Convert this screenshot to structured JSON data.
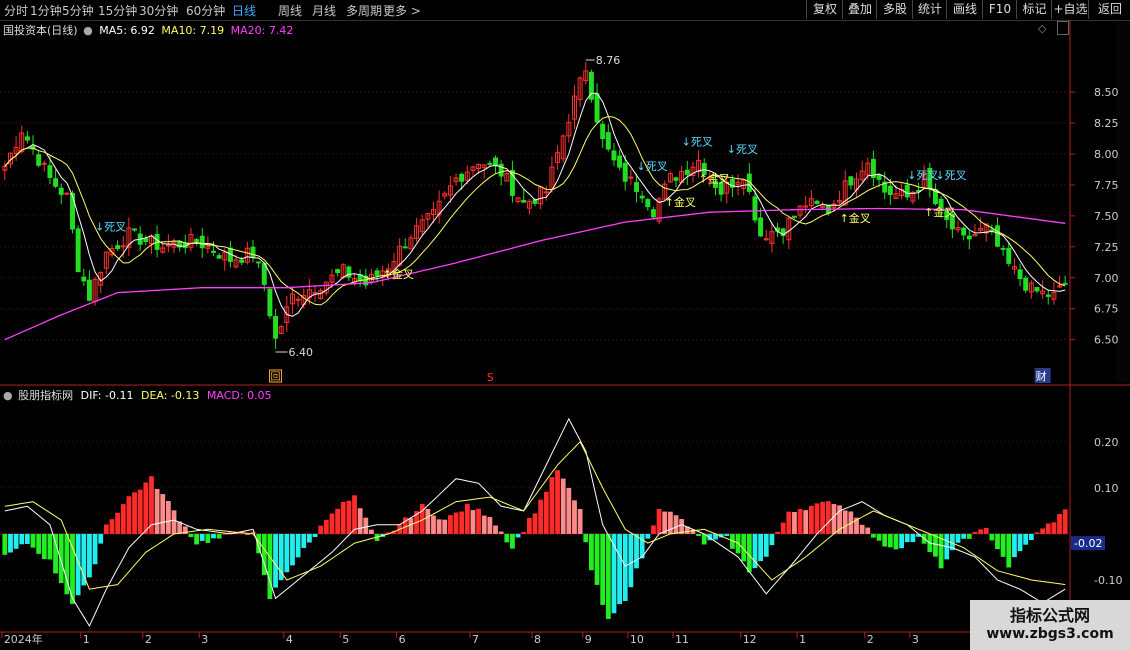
{
  "toolbar": {
    "periods": [
      "分时",
      "1分钟",
      "5分钟",
      "15分钟",
      "30分钟",
      "60分钟",
      "日线",
      "周线",
      "月线",
      "多周期",
      "更多 >"
    ],
    "active_period": "日线",
    "tools": [
      "复权",
      "叠加",
      "多股",
      "统计",
      "画线",
      "F10",
      "标记",
      "+自选",
      "返回"
    ]
  },
  "price_panel": {
    "title": "国投资本(日线)",
    "ma5_label": "MA5: 6.92",
    "ma10_label": "MA10: 7.19",
    "ma20_label": "MA20: 7.42",
    "max_label": "8.76",
    "min_label": "6.40",
    "markers": {
      "hui": "回",
      "s": "S",
      "cai": "财"
    },
    "colors": {
      "up": "#ff3030",
      "down": "#22dd22",
      "ma5": "#ffffff",
      "ma10": "#ffff66",
      "ma20": "#ff40ff"
    }
  },
  "macd_panel": {
    "title": "股朋指标网",
    "dif_label": "DIF: -0.11",
    "dea_label": "DEA: -0.13",
    "macd_label": "MACD: 0.05",
    "current_value": "-0.02"
  },
  "watermark": {
    "line1": "指标公式网",
    "line2": "www.zbgs3.com"
  },
  "chart_data": [
    {
      "type": "candlestick",
      "title": "国投资本(日线)",
      "y_ticks": [
        8.5,
        8.25,
        8.0,
        7.75,
        7.5,
        7.25,
        7.0,
        6.75,
        6.5
      ],
      "ylim": [
        6.4,
        8.76
      ],
      "x_ticks": [
        "2024年",
        "1",
        "2",
        "3",
        "4",
        "5",
        "6",
        "7",
        "8",
        "9",
        "10",
        "11",
        "12",
        "1",
        "2",
        "3"
      ],
      "x_tick_days": [
        0,
        14,
        25,
        35,
        50,
        60,
        70,
        83,
        94,
        103,
        111,
        119,
        131,
        141,
        153,
        161
      ],
      "close_keypoints": [
        [
          0,
          7.9
        ],
        [
          3,
          8.2
        ],
        [
          8,
          7.8
        ],
        [
          11,
          7.65
        ],
        [
          13,
          7.1
        ],
        [
          15,
          6.85
        ],
        [
          18,
          7.2
        ],
        [
          22,
          7.35
        ],
        [
          28,
          7.25
        ],
        [
          34,
          7.3
        ],
        [
          40,
          7.15
        ],
        [
          44,
          7.2
        ],
        [
          46,
          6.95
        ],
        [
          48,
          6.5
        ],
        [
          51,
          6.85
        ],
        [
          56,
          6.95
        ],
        [
          60,
          7.05
        ],
        [
          64,
          6.95
        ],
        [
          68,
          7.1
        ],
        [
          72,
          7.35
        ],
        [
          76,
          7.5
        ],
        [
          80,
          7.8
        ],
        [
          84,
          7.95
        ],
        [
          88,
          7.85
        ],
        [
          92,
          7.6
        ],
        [
          96,
          7.7
        ],
        [
          100,
          8.3
        ],
        [
          103,
          8.7
        ],
        [
          106,
          8.1
        ],
        [
          109,
          7.85
        ],
        [
          113,
          7.7
        ],
        [
          115,
          7.55
        ],
        [
          118,
          7.8
        ],
        [
          123,
          7.95
        ],
        [
          127,
          7.7
        ],
        [
          131,
          7.85
        ],
        [
          134,
          7.35
        ],
        [
          138,
          7.4
        ],
        [
          142,
          7.6
        ],
        [
          146,
          7.55
        ],
        [
          150,
          7.8
        ],
        [
          153,
          7.95
        ],
        [
          156,
          7.7
        ],
        [
          160,
          7.65
        ],
        [
          163,
          7.8
        ],
        [
          166,
          7.5
        ],
        [
          170,
          7.3
        ],
        [
          174,
          7.4
        ],
        [
          178,
          7.1
        ],
        [
          182,
          6.9
        ],
        [
          186,
          6.85
        ],
        [
          188,
          6.95
        ]
      ],
      "series": [
        {
          "name": "MA5",
          "value": 6.92
        },
        {
          "name": "MA10",
          "value": 7.19
        },
        {
          "name": "MA20",
          "value": 7.42,
          "keypoints": [
            [
              0,
              6.5
            ],
            [
              10,
              6.7
            ],
            [
              20,
              6.88
            ],
            [
              35,
              6.92
            ],
            [
              50,
              6.92
            ],
            [
              65,
              6.96
            ],
            [
              80,
              7.12
            ],
            [
              95,
              7.3
            ],
            [
              110,
              7.45
            ],
            [
              125,
              7.53
            ],
            [
              140,
              7.55
            ],
            [
              155,
              7.56
            ],
            [
              170,
              7.55
            ],
            [
              188,
              7.44
            ]
          ]
        }
      ],
      "annotations": [
        {
          "day": 16,
          "price": 7.38,
          "text": "↓死叉",
          "kind": "death"
        },
        {
          "day": 67,
          "price": 7.0,
          "text": "↑金叉",
          "kind": "golden"
        },
        {
          "day": 112,
          "price": 7.87,
          "text": "↓死叉",
          "kind": "death"
        },
        {
          "day": 120,
          "price": 8.07,
          "text": "↓死叉",
          "kind": "death"
        },
        {
          "day": 117,
          "price": 7.58,
          "text": "↑金叉",
          "kind": "golden"
        },
        {
          "day": 123,
          "price": 7.77,
          "text": "↑金叉",
          "kind": "golden"
        },
        {
          "day": 128,
          "price": 8.01,
          "text": "↓死叉",
          "kind": "death"
        },
        {
          "day": 148,
          "price": 7.45,
          "text": "↑金叉",
          "kind": "golden"
        },
        {
          "day": 160,
          "price": 7.8,
          "text": "↓死叉",
          "kind": "death"
        },
        {
          "day": 165,
          "price": 7.8,
          "text": "↓死叉",
          "kind": "death"
        },
        {
          "day": 163,
          "price": 7.5,
          "text": "↑金叉",
          "kind": "golden"
        }
      ]
    },
    {
      "type": "bar",
      "title": "股朋指标网",
      "y_ticks": [
        0.2,
        0.1,
        -0.1
      ],
      "ylim": [
        -0.2,
        0.28
      ],
      "macd_keypoints": [
        [
          0,
          -0.05
        ],
        [
          4,
          -0.02
        ],
        [
          8,
          -0.06
        ],
        [
          12,
          -0.15
        ],
        [
          15,
          -0.1
        ],
        [
          18,
          0.02
        ],
        [
          22,
          0.08
        ],
        [
          26,
          0.12
        ],
        [
          30,
          0.05
        ],
        [
          34,
          -0.02
        ],
        [
          38,
          -0.01
        ],
        [
          42,
          0.01
        ],
        [
          44,
          0.0
        ],
        [
          47,
          -0.14
        ],
        [
          50,
          -0.08
        ],
        [
          54,
          -0.02
        ],
        [
          58,
          0.05
        ],
        [
          62,
          0.08
        ],
        [
          66,
          -0.02
        ],
        [
          70,
          0.02
        ],
        [
          74,
          0.06
        ],
        [
          78,
          0.03
        ],
        [
          82,
          0.06
        ],
        [
          86,
          0.04
        ],
        [
          90,
          -0.03
        ],
        [
          94,
          0.05
        ],
        [
          98,
          0.14
        ],
        [
          102,
          0.05
        ],
        [
          104,
          -0.08
        ],
        [
          107,
          -0.19
        ],
        [
          110,
          -0.14
        ],
        [
          113,
          -0.05
        ],
        [
          116,
          0.06
        ],
        [
          120,
          0.03
        ],
        [
          124,
          -0.02
        ],
        [
          128,
          -0.01
        ],
        [
          132,
          -0.08
        ],
        [
          135,
          -0.05
        ],
        [
          139,
          0.05
        ],
        [
          143,
          0.06
        ],
        [
          147,
          0.07
        ],
        [
          151,
          0.04
        ],
        [
          155,
          -0.02
        ],
        [
          158,
          -0.03
        ],
        [
          162,
          -0.01
        ],
        [
          166,
          -0.07
        ],
        [
          170,
          -0.01
        ],
        [
          174,
          0.01
        ],
        [
          178,
          -0.07
        ],
        [
          182,
          -0.01
        ],
        [
          185,
          0.02
        ],
        [
          188,
          0.05
        ]
      ],
      "dif_keypoints": [
        [
          0,
          0.05
        ],
        [
          4,
          0.06
        ],
        [
          8,
          0.02
        ],
        [
          12,
          -0.14
        ],
        [
          15,
          -0.2
        ],
        [
          18,
          -0.12
        ],
        [
          22,
          -0.03
        ],
        [
          26,
          0.02
        ],
        [
          30,
          0.03
        ],
        [
          34,
          0.01
        ],
        [
          40,
          0.0
        ],
        [
          44,
          0.01
        ],
        [
          48,
          -0.14
        ],
        [
          52,
          -0.1
        ],
        [
          58,
          -0.04
        ],
        [
          62,
          0.01
        ],
        [
          66,
          0.02
        ],
        [
          70,
          0.02
        ],
        [
          74,
          0.05
        ],
        [
          80,
          0.12
        ],
        [
          84,
          0.11
        ],
        [
          88,
          0.06
        ],
        [
          92,
          0.05
        ],
        [
          96,
          0.15
        ],
        [
          100,
          0.25
        ],
        [
          103,
          0.18
        ],
        [
          106,
          0.02
        ],
        [
          110,
          -0.07
        ],
        [
          113,
          -0.05
        ],
        [
          116,
          0.0
        ],
        [
          120,
          0.02
        ],
        [
          124,
          0.0
        ],
        [
          130,
          -0.05
        ],
        [
          135,
          -0.13
        ],
        [
          140,
          -0.06
        ],
        [
          144,
          0.0
        ],
        [
          148,
          0.05
        ],
        [
          152,
          0.07
        ],
        [
          156,
          0.04
        ],
        [
          160,
          0.02
        ],
        [
          164,
          -0.02
        ],
        [
          168,
          -0.03
        ],
        [
          172,
          -0.05
        ],
        [
          176,
          -0.1
        ],
        [
          180,
          -0.12
        ],
        [
          184,
          -0.15
        ],
        [
          188,
          -0.12
        ]
      ],
      "dea_keypoints": [
        [
          0,
          0.06
        ],
        [
          5,
          0.07
        ],
        [
          10,
          0.03
        ],
        [
          15,
          -0.12
        ],
        [
          20,
          -0.11
        ],
        [
          25,
          -0.04
        ],
        [
          30,
          0.0
        ],
        [
          36,
          0.01
        ],
        [
          44,
          0.0
        ],
        [
          50,
          -0.1
        ],
        [
          56,
          -0.07
        ],
        [
          62,
          -0.02
        ],
        [
          68,
          0.0
        ],
        [
          74,
          0.03
        ],
        [
          80,
          0.07
        ],
        [
          86,
          0.08
        ],
        [
          92,
          0.05
        ],
        [
          98,
          0.15
        ],
        [
          102,
          0.2
        ],
        [
          106,
          0.1
        ],
        [
          110,
          0.01
        ],
        [
          114,
          -0.02
        ],
        [
          118,
          0.0
        ],
        [
          124,
          0.01
        ],
        [
          130,
          -0.02
        ],
        [
          136,
          -0.1
        ],
        [
          142,
          -0.05
        ],
        [
          148,
          0.01
        ],
        [
          154,
          0.05
        ],
        [
          158,
          0.03
        ],
        [
          164,
          0.0
        ],
        [
          170,
          -0.03
        ],
        [
          176,
          -0.08
        ],
        [
          182,
          -0.1
        ],
        [
          188,
          -0.11
        ]
      ]
    }
  ]
}
